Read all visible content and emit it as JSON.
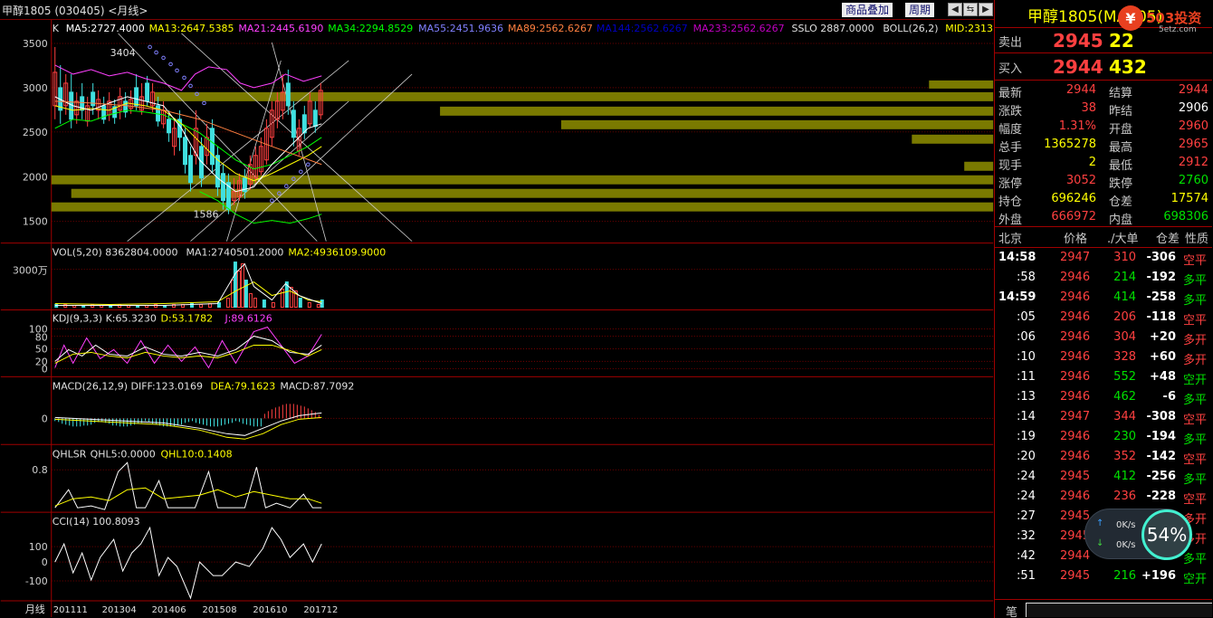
{
  "toolbar": {
    "title": "甲醇1805 (030405) <月线>",
    "overlay_label": "商品叠加",
    "period_label": "周期",
    "nav_icons": [
      "prev-icon",
      "swap-icon",
      "next-icon",
      "full-icon"
    ]
  },
  "ma_line": {
    "k": "K",
    "items": [
      {
        "text": "MA5:2727.4000",
        "color": "#ffffff"
      },
      {
        "text": "MA13:2647.5385",
        "color": "#ffff00"
      },
      {
        "text": "MA21:2445.6190",
        "color": "#ff40ff"
      },
      {
        "text": "MA34:2294.8529",
        "color": "#00ff00"
      },
      {
        "text": "MA55:2451.9636",
        "color": "#8080ff"
      },
      {
        "text": "MA89:2562.6267",
        "color": "#ff8040"
      },
      {
        "text": "MA144:2562.6267",
        "color": "#0000c0"
      },
      {
        "text": "MA233:2562.6267",
        "color": "#c000c0"
      },
      {
        "text": "SSLO 2887.0000",
        "color": "#e0e0e0"
      },
      {
        "text": "BOLL(26,2)",
        "color": "#e0e0e0"
      },
      {
        "text": "MID:2313",
        "color": "#ffff00"
      }
    ],
    "y_ticks": [
      "3500",
      "3000",
      "2500",
      "2000",
      "1500"
    ],
    "marker_high": "3404",
    "marker_low": "1586"
  },
  "vol": {
    "title": "VOL(5,20) 8362804.0000",
    "ma1": "MA1:2740501.2000",
    "ma2": "MA2:4936109.9000",
    "tick": "3000万"
  },
  "kdj": {
    "title": "KDJ(9,3,3) K:65.3230",
    "d": "D:53.1782",
    "j": "J:89.6126",
    "ticks": [
      "100",
      "80",
      "50",
      "20",
      "0"
    ]
  },
  "macd": {
    "title": "MACD(26,12,9) DIFF:123.0169",
    "dea": "DEA:79.1623",
    "macd": "MACD:87.7092",
    "tick": "0"
  },
  "qhlsr": {
    "title": "QHLSR",
    "q5": "QHL5:0.0000",
    "q10": "QHL10:0.1408",
    "tick": "0.8"
  },
  "cci": {
    "title": "CCI(14) 100.8093",
    "ticks": [
      "100",
      "0",
      "-100"
    ]
  },
  "xaxis": {
    "label": "月线",
    "dates": [
      "201111",
      "201304",
      "201406",
      "201508",
      "201610",
      "201712"
    ]
  },
  "quote": {
    "name": "甲醇1805(MA805)",
    "logo": "503投资",
    "logo_sub": "5etz.com",
    "ask_label": "卖出",
    "ask_price": "2945",
    "ask_vol": "22",
    "bid_label": "买入",
    "bid_price": "2944",
    "bid_vol": "432",
    "stats": [
      {
        "l": "最新",
        "v": "2944",
        "vc": "red",
        "l2": "结算",
        "v2": "2944",
        "v2c": "red"
      },
      {
        "l": "涨跌",
        "v": "38",
        "vc": "red",
        "l2": "昨结",
        "v2": "2906",
        "v2c": "white"
      },
      {
        "l": "幅度",
        "v": "1.31%",
        "vc": "red",
        "l2": "开盘",
        "v2": "2960",
        "v2c": "red"
      },
      {
        "l": "总手",
        "v": "1365278",
        "vc": "yellow",
        "l2": "最高",
        "v2": "2965",
        "v2c": "red"
      },
      {
        "l": "现手",
        "v": "2",
        "vc": "yellow",
        "l2": "最低",
        "v2": "2912",
        "v2c": "red"
      },
      {
        "l": "涨停",
        "v": "3052",
        "vc": "red",
        "l2": "跌停",
        "v2": "2760",
        "v2c": "green"
      },
      {
        "l": "持仓",
        "v": "696246",
        "vc": "yellow",
        "l2": "仓差",
        "v2": "17574",
        "v2c": "yellow"
      },
      {
        "l": "外盘",
        "v": "666972",
        "vc": "red",
        "l2": "内盘",
        "v2": "698306",
        "v2c": "green"
      }
    ],
    "tick_header": {
      "time": "北京",
      "price": "价格",
      "vol": "./大单",
      "diff": "仓差",
      "nature": "性质"
    },
    "ticks": [
      {
        "t": "14:58",
        "p": "2947",
        "v": "310",
        "vc": "red",
        "d": "-306",
        "n": "空平",
        "nc": "red"
      },
      {
        "t": ":58",
        "p": "2946",
        "v": "214",
        "vc": "green",
        "d": "-192",
        "n": "多平",
        "nc": "green"
      },
      {
        "t": "14:59",
        "p": "2946",
        "v": "414",
        "vc": "green",
        "d": "-258",
        "n": "多平",
        "nc": "green"
      },
      {
        "t": ":05",
        "p": "2946",
        "v": "206",
        "vc": "red",
        "d": "-118",
        "n": "空平",
        "nc": "red"
      },
      {
        "t": ":06",
        "p": "2946",
        "v": "304",
        "vc": "red",
        "d": "+20",
        "n": "多开",
        "nc": "red"
      },
      {
        "t": ":10",
        "p": "2946",
        "v": "328",
        "vc": "red",
        "d": "+60",
        "n": "多开",
        "nc": "red"
      },
      {
        "t": ":11",
        "p": "2946",
        "v": "552",
        "vc": "green",
        "d": "+48",
        "n": "空开",
        "nc": "green"
      },
      {
        "t": ":13",
        "p": "2946",
        "v": "462",
        "vc": "green",
        "d": "-6",
        "n": "多平",
        "nc": "green"
      },
      {
        "t": ":14",
        "p": "2947",
        "v": "344",
        "vc": "red",
        "d": "-308",
        "n": "空平",
        "nc": "red"
      },
      {
        "t": ":19",
        "p": "2946",
        "v": "230",
        "vc": "green",
        "d": "-194",
        "n": "多平",
        "nc": "green"
      },
      {
        "t": ":20",
        "p": "2946",
        "v": "352",
        "vc": "red",
        "d": "-142",
        "n": "空平",
        "nc": "red"
      },
      {
        "t": ":24",
        "p": "2945",
        "v": "412",
        "vc": "green",
        "d": "-256",
        "n": "多平",
        "nc": "green"
      },
      {
        "t": ":24",
        "p": "2946",
        "v": "236",
        "vc": "red",
        "d": "-228",
        "n": "空平",
        "nc": "red"
      },
      {
        "t": ":27",
        "p": "2945",
        "v": "572",
        "vc": "red",
        "d": "+70",
        "n": "多开",
        "nc": "red"
      },
      {
        "t": ":32",
        "p": "2945",
        "v": "",
        "vc": "red",
        "d": "",
        "n": "多开",
        "nc": "red"
      },
      {
        "t": ":42",
        "p": "2944",
        "v": "236",
        "vc": "green",
        "d": "-190",
        "n": "多平",
        "nc": "green"
      },
      {
        "t": ":51",
        "p": "2945",
        "v": "216",
        "vc": "green",
        "d": "+196",
        "n": "空开",
        "nc": "green"
      }
    ],
    "bottom_tab": "笔"
  },
  "speed": {
    "up": "0K/s",
    "down": "0K/s",
    "pct": "54%"
  }
}
